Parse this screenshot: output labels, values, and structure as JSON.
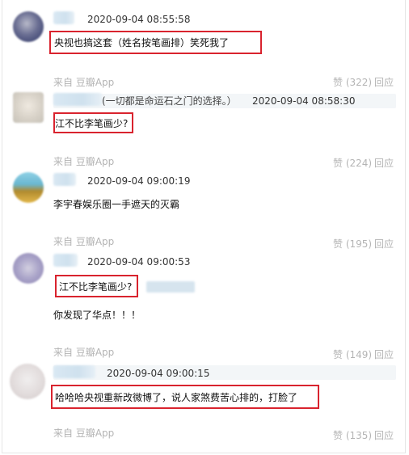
{
  "comments": [
    {
      "timestamp": "2020-09-04 08:55:58",
      "text": "央视也搞这套（姓名按笔画排）笑死我了",
      "from": "来自 豆瓣App",
      "likes": "赞 (322)",
      "reply": "回应"
    },
    {
      "quote_ref": "(一切都是命运石之门的选择。）",
      "timestamp": "2020-09-04 08:58:30",
      "text": "江不比李笔画少?",
      "from": "来自 豆瓣App",
      "likes": "赞 (224)",
      "reply": "回应"
    },
    {
      "timestamp": "2020-09-04 09:00:19",
      "text": "李宇春娱乐圈一手遮天的灭霸",
      "from": "来自 豆瓣App",
      "likes": "赞 (195)",
      "reply": "回应"
    },
    {
      "timestamp": "2020-09-04 09:00:53",
      "quote_text": "江不比李笔画少?",
      "text": "你发现了华点！！！",
      "from": "来自 豆瓣App",
      "likes": "赞 (149)",
      "reply": "回应"
    },
    {
      "timestamp": "2020-09-04 09:00:15",
      "text": "哈哈哈央视重新改微博了，说人家煞费苦心排的，打脸了",
      "from": "来自 豆瓣App",
      "likes": "赞 (135)",
      "reply": "回应"
    }
  ]
}
